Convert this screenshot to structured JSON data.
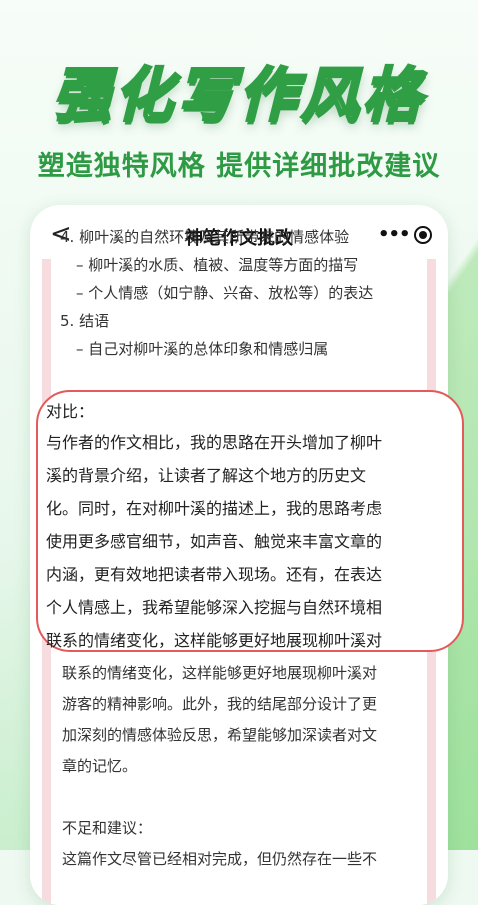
{
  "banner": {
    "headline": "强化写作风格",
    "subline": "塑造独特风格 提供详细批改建议"
  },
  "navbar": {
    "back_glyph": "<",
    "title": "神笔作文批改",
    "more_glyph": "•••"
  },
  "doc": {
    "lines": [
      "4. 柳叶溪的自然环境及其所带来的情感体验",
      "– 柳叶溪的水质、植被、温度等方面的描写",
      "– 个人情感（如宁静、兴奋、放松等）的表达",
      "5. 结语",
      "– 自己对柳叶溪的总体印象和情感归属"
    ]
  },
  "highlight": {
    "lines": [
      "对比：",
      "与作者的作文相比，我的思路在开头增加了柳叶",
      "溪的背景介绍，让读者了解这个地方的历史文",
      "化。同时，在对柳叶溪的描述上，我的思路考虑",
      "使用更多感官细节，如声音、触觉来丰富文章的",
      "内涵，更有效地把读者带入现场。还有，在表达",
      "个人情感上，我希望能够深入挖掘与自然环境相",
      "联系的情绪变化，这样能够更好地展现柳叶溪对"
    ]
  },
  "after": {
    "lines": [
      "联系的情绪变化，这样能够更好地展现柳叶溪对",
      "游客的精神影响。此外，我的结尾部分设计了更",
      "加深刻的情感体验反思，希望能够加深读者对文",
      "章的记忆。",
      "",
      "不足和建议：",
      "这篇作文尽管已经相对完成，但仍然存在一些不"
    ]
  }
}
